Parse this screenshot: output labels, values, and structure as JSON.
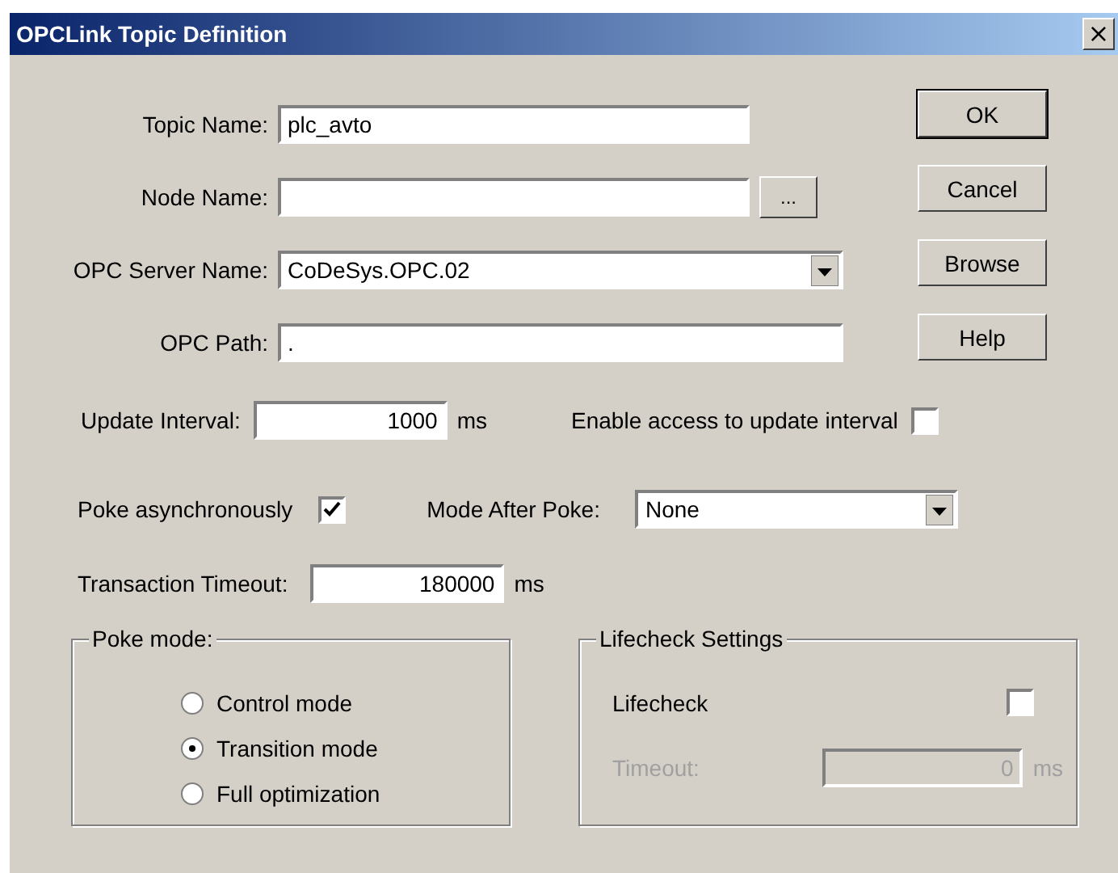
{
  "window": {
    "title": "OPCLink Topic Definition",
    "close": "×"
  },
  "fields": [
    {
      "label": "Topic Name:",
      "value": "plc_avto",
      "kind": "text"
    },
    {
      "label": "Node Name:",
      "kind": "browse",
      "button": "..."
    },
    {
      "label": "OPC Server Name:",
      "value": "CoDeSys.OPC.02",
      "kind": "dropdown"
    },
    {
      "label": "OPC Path:",
      "value": ".",
      "kind": "text"
    }
  ],
  "buttons": [
    "OK",
    "Cancel",
    "Browse",
    "Help"
  ],
  "update_interval": {
    "label": "Update Interval:",
    "value": "1000",
    "unit": "ms"
  },
  "enable_access": {
    "label": "Enable access to update interval",
    "checked": false
  },
  "poke_async": {
    "label": "Poke asynchronously",
    "checked": true
  },
  "mode_after_poke": {
    "label": "Mode After Poke:",
    "value": "None"
  },
  "transaction_timeout": {
    "label": "Transaction Timeout:",
    "value": "180000",
    "unit": "ms"
  },
  "poke_mode": {
    "title": "Poke mode:",
    "options": [
      {
        "label": "Control mode",
        "selected": false
      },
      {
        "label": "Transition mode",
        "selected": true
      },
      {
        "label": "Full optimization",
        "selected": false
      }
    ]
  },
  "lifecheck": {
    "title": "Lifecheck Settings",
    "label": "Lifecheck",
    "checked": false,
    "timeout_label": "Timeout:",
    "timeout_value": "0",
    "timeout_unit": "ms",
    "disabled": true
  }
}
